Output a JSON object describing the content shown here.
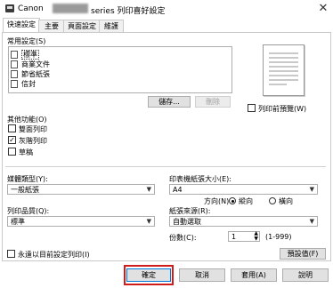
{
  "window": {
    "title_prefix": "Canon",
    "title_suffix": "series 列印喜好設定",
    "close_glyph": "✕"
  },
  "tabs": [
    {
      "label": "快速設定",
      "active": true
    },
    {
      "label": "主要",
      "active": false
    },
    {
      "label": "頁面設定",
      "active": false
    },
    {
      "label": "維護",
      "active": false
    }
  ],
  "common_settings": {
    "label": "常用設定(S)",
    "items": [
      {
        "label": "標準",
        "selected": true
      },
      {
        "label": "商業文件",
        "selected": false
      },
      {
        "label": "節省紙張",
        "selected": false
      },
      {
        "label": "信封",
        "selected": false
      }
    ],
    "save_button": "儲存...",
    "delete_button": "刪除"
  },
  "preview_checkbox_label": "列印前預覽(W)",
  "other_features": {
    "label": "其他功能(O)",
    "items": [
      {
        "label": "雙面列印",
        "checked": false
      },
      {
        "label": "灰階列印",
        "checked": true
      },
      {
        "label": "草稿",
        "checked": false
      }
    ]
  },
  "media_type": {
    "label": "媒體類型(Y):",
    "value": "一般紙張"
  },
  "paper_size": {
    "label": "印表機紙張大小(E):",
    "value": "A4"
  },
  "orientation": {
    "label": "方向(N):",
    "portrait": "縱向",
    "landscape": "橫向",
    "selected": "portrait"
  },
  "print_quality": {
    "label": "列印品質(Q):",
    "value": "標準"
  },
  "paper_source": {
    "label": "紙張來源(R):",
    "value": "自動選取"
  },
  "copies": {
    "label": "份數(C):",
    "value": "1",
    "range": "(1-999)"
  },
  "always_print_checkbox": "永遠以目前設定列印(I)",
  "defaults_button": "預設值(F)",
  "buttons": {
    "ok": "確定",
    "cancel": "取消",
    "apply": "套用(A)",
    "help": "說明"
  },
  "colors": {
    "highlight": "#d11c1c",
    "panel_border": "#c9c9c9"
  }
}
